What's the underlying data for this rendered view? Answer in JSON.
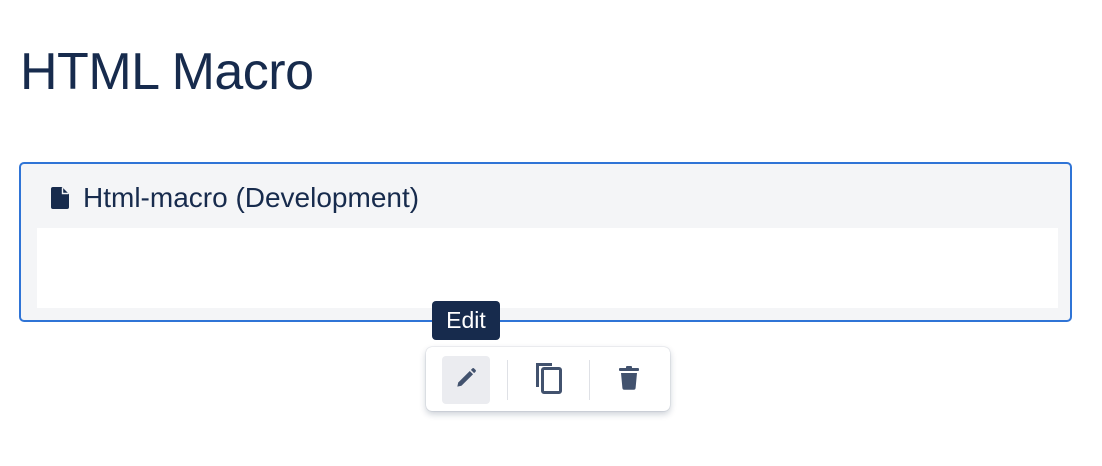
{
  "page": {
    "title": "HTML Macro"
  },
  "macro": {
    "title": "Html-macro (Development)",
    "icon": "file-icon"
  },
  "tooltip": {
    "text": "Edit"
  },
  "toolbar": {
    "buttons": [
      {
        "name": "edit",
        "icon": "pencil-icon",
        "active": true
      },
      {
        "name": "copy",
        "icon": "copy-icon",
        "active": false
      },
      {
        "name": "delete",
        "icon": "trash-icon",
        "active": false
      }
    ]
  },
  "colors": {
    "text_primary": "#172b4d",
    "focus_border": "#2f74d6",
    "macro_bg": "#f4f5f7",
    "icon_gray": "#42526e",
    "active_button_bg": "#ebecf0"
  }
}
